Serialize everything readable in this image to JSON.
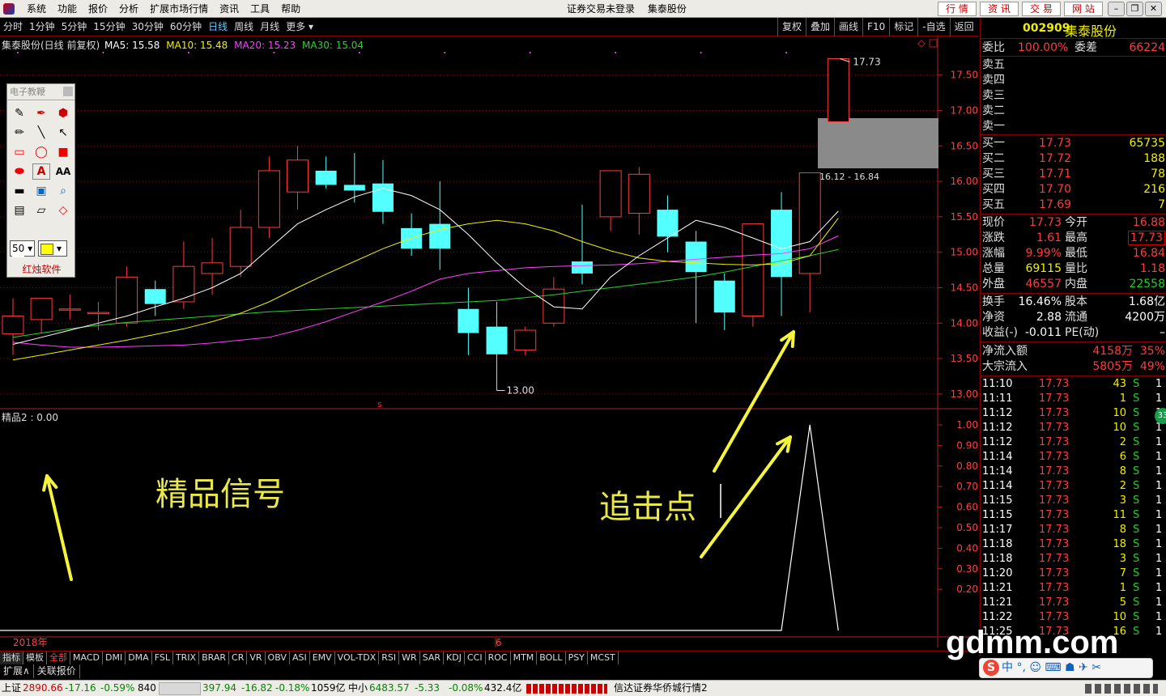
{
  "menubar": {
    "items": [
      "系统",
      "功能",
      "报价",
      "分析",
      "扩展市场行情",
      "资讯",
      "工具",
      "帮助"
    ],
    "status": "证券交易未登录",
    "stock": "集泰股份",
    "right_buttons": [
      "行 情",
      "资 讯",
      "交 易",
      "网 站"
    ]
  },
  "timeframes": {
    "items": [
      "分时",
      "1分钟",
      "5分钟",
      "15分钟",
      "30分钟",
      "60分钟",
      "日线",
      "周线",
      "月线",
      "更多 ▾"
    ],
    "active": "日线",
    "right_items": [
      "复权",
      "叠加",
      "画线",
      "F10",
      "标记",
      "-自选",
      "返回"
    ]
  },
  "chart_info": {
    "title": "集泰股份(日线 前复权)",
    "ma5": "MA5: 15.58",
    "ma10": "MA10: 15.48",
    "ma20": "MA20: 15.23",
    "ma30": "MA30: 15.04",
    "ma_colors": {
      "ma5": "#ffffff",
      "ma10": "#f0f000",
      "ma20": "#ff40ff",
      "ma30": "#30d030"
    }
  },
  "drawing_tools": {
    "title": "电子教鞭",
    "size_value": "50",
    "brand": "红烛软件",
    "tool_icons": [
      "eraser-icon",
      "pen-icon",
      "paint-icon",
      "brush-icon",
      "line-icon",
      "arrow-icon",
      "rect-outline-icon",
      "ellipse-outline-icon",
      "rect-fill-icon",
      "ellipse-fill-icon",
      "text-a-icon",
      "text-aa-icon",
      "black-bar-icon",
      "screen-icon",
      "magnifier-icon",
      "save-icon",
      "open-icon",
      "diamond-icon"
    ],
    "text_glyphs": {
      "text_a": "A",
      "text_aa": "AA"
    }
  },
  "chart_data": {
    "type": "candlestick",
    "y_ticks": [
      "17.50",
      "17.00",
      "16.50",
      "16.00",
      "15.50",
      "15.00",
      "14.50",
      "14.00",
      "13.50",
      "13.00"
    ],
    "ylim": [
      12.85,
      17.85
    ],
    "up_color": "#ff3b3b",
    "down_color": "#54ffff",
    "candles": [
      {
        "o": 13.85,
        "h": 14.35,
        "l": 13.55,
        "c": 14.1
      },
      {
        "o": 14.05,
        "h": 14.35,
        "l": 13.85,
        "c": 14.35
      },
      {
        "o": 14.2,
        "h": 14.4,
        "l": 14.05,
        "c": 14.2
      },
      {
        "o": 14.15,
        "h": 14.3,
        "l": 13.9,
        "c": 14.15
      },
      {
        "o": 14.0,
        "h": 14.8,
        "l": 13.95,
        "c": 14.65
      },
      {
        "o": 14.48,
        "h": 14.6,
        "l": 14.1,
        "c": 14.27
      },
      {
        "o": 14.3,
        "h": 15.15,
        "l": 14.2,
        "c": 14.8
      },
      {
        "o": 14.7,
        "h": 15.2,
        "l": 14.4,
        "c": 14.85
      },
      {
        "o": 14.8,
        "h": 15.6,
        "l": 14.65,
        "c": 15.35
      },
      {
        "o": 15.35,
        "h": 16.35,
        "l": 15.2,
        "c": 16.15
      },
      {
        "o": 15.85,
        "h": 16.5,
        "l": 15.6,
        "c": 16.3
      },
      {
        "o": 16.15,
        "h": 16.35,
        "l": 15.9,
        "c": 15.95
      },
      {
        "o": 15.95,
        "h": 16.4,
        "l": 15.7,
        "c": 15.87
      },
      {
        "o": 15.97,
        "h": 16.3,
        "l": 15.4,
        "c": 15.57
      },
      {
        "o": 15.34,
        "h": 15.55,
        "l": 14.95,
        "c": 15.05
      },
      {
        "o": 15.4,
        "h": 16.0,
        "l": 14.75,
        "c": 15.05
      },
      {
        "o": 14.2,
        "h": 14.5,
        "l": 13.55,
        "c": 13.86
      },
      {
        "o": 13.95,
        "h": 14.3,
        "l": 13.05,
        "c": 13.56
      },
      {
        "o": 13.62,
        "h": 13.95,
        "l": 13.55,
        "c": 13.9
      },
      {
        "o": 14.0,
        "h": 14.65,
        "l": 13.95,
        "c": 14.48
      },
      {
        "o": 14.87,
        "h": 15.67,
        "l": 14.55,
        "c": 14.7
      },
      {
        "o": 15.5,
        "h": 16.15,
        "l": 15.3,
        "c": 16.15
      },
      {
        "o": 15.55,
        "h": 16.2,
        "l": 15.25,
        "c": 16.1
      },
      {
        "o": 15.6,
        "h": 15.8,
        "l": 15.0,
        "c": 15.22
      },
      {
        "o": 15.15,
        "h": 15.3,
        "l": 14.0,
        "c": 14.72
      },
      {
        "o": 14.6,
        "h": 14.7,
        "l": 13.9,
        "c": 14.15
      },
      {
        "o": 14.1,
        "h": 15.4,
        "l": 13.95,
        "c": 15.4
      },
      {
        "o": 15.6,
        "h": 15.85,
        "l": 14.1,
        "c": 14.65
      },
      {
        "o": 14.7,
        "h": 16.12,
        "l": 14.15,
        "c": 16.12
      },
      {
        "o": 16.84,
        "h": 17.73,
        "l": 16.84,
        "c": 17.73
      }
    ],
    "ma5": [
      13.7,
      13.8,
      13.9,
      14.0,
      14.1,
      14.23,
      14.35,
      14.5,
      14.7,
      15.05,
      15.4,
      15.6,
      15.78,
      15.9,
      15.8,
      15.6,
      15.25,
      14.85,
      14.5,
      14.23,
      14.2,
      14.65,
      14.95,
      15.2,
      15.45,
      15.35,
      15.2,
      15.05,
      15.15,
      15.58
    ],
    "ma10": [
      13.48,
      13.55,
      13.62,
      13.69,
      13.76,
      13.84,
      13.92,
      14.02,
      14.14,
      14.3,
      14.5,
      14.69,
      14.87,
      15.05,
      15.2,
      15.32,
      15.4,
      15.45,
      15.4,
      15.3,
      15.15,
      15.02,
      14.92,
      14.87,
      14.85,
      14.83,
      14.82,
      14.84,
      14.95,
      15.48
    ],
    "ma20": [
      13.73,
      13.69,
      13.66,
      13.66,
      13.67,
      13.68,
      13.69,
      13.72,
      13.76,
      13.8,
      13.9,
      14.02,
      14.16,
      14.3,
      14.45,
      14.62,
      14.7,
      14.74,
      14.78,
      14.8,
      14.81,
      14.82,
      14.84,
      14.87,
      14.9,
      14.93,
      14.96,
      14.98,
      15.05,
      15.23
    ],
    "ma30": [
      13.8,
      13.86,
      13.92,
      13.97,
      14.01,
      14.04,
      14.07,
      14.1,
      14.13,
      14.16,
      14.18,
      14.2,
      14.22,
      14.24,
      14.26,
      14.28,
      14.3,
      14.32,
      14.36,
      14.4,
      14.45,
      14.5,
      14.55,
      14.6,
      14.65,
      14.72,
      14.8,
      14.88,
      14.95,
      15.04
    ],
    "max_label": "17.73",
    "min_label": "13.00",
    "range_label": "16.12 - 16.84",
    "indicator": {
      "name": "精品2 : 0.00",
      "y_ticks": [
        "1.00",
        "0.90",
        "0.80",
        "0.70",
        "0.60",
        "0.50",
        "0.40",
        "0.30",
        "0.20"
      ],
      "ylim": [
        0,
        1
      ],
      "signal": [
        0,
        0,
        0,
        0,
        0,
        0,
        0,
        0,
        0,
        0,
        0,
        0,
        0,
        0,
        0,
        0,
        0,
        0,
        0,
        0,
        0,
        0,
        0,
        0,
        0,
        0,
        0,
        0,
        1,
        0
      ]
    },
    "x_labels": [
      "2018年",
      "6"
    ]
  },
  "annotations": {
    "signal_label": "精品信号",
    "chase_label": "追击点"
  },
  "quote_panel": {
    "code": "002909",
    "name": "集泰股份",
    "weibi": {
      "label": "委比",
      "value": "100.00%",
      "label2": "委差",
      "value2": "66224"
    },
    "sells": [
      {
        "label": "卖五",
        "price": "",
        "vol": ""
      },
      {
        "label": "卖四",
        "price": "",
        "vol": ""
      },
      {
        "label": "卖三",
        "price": "",
        "vol": ""
      },
      {
        "label": "卖二",
        "price": "",
        "vol": ""
      },
      {
        "label": "卖一",
        "price": "",
        "vol": ""
      }
    ],
    "buys": [
      {
        "label": "买一",
        "price": "17.73",
        "vol": "65735"
      },
      {
        "label": "买二",
        "price": "17.72",
        "vol": "188"
      },
      {
        "label": "买三",
        "price": "17.71",
        "vol": "78"
      },
      {
        "label": "买四",
        "price": "17.70",
        "vol": "216"
      },
      {
        "label": "买五",
        "price": "17.69",
        "vol": "7"
      }
    ],
    "stats": [
      {
        "l1": "现价",
        "v1": "17.73",
        "c1": "red",
        "l2": "今开",
        "v2": "16.88",
        "c2": "red"
      },
      {
        "l1": "涨跌",
        "v1": "1.61",
        "c1": "red",
        "l2": "最高",
        "v2": "17.73",
        "c2": "red"
      },
      {
        "l1": "涨幅",
        "v1": "9.99%",
        "c1": "red",
        "l2": "最低",
        "v2": "16.84",
        "c2": "red"
      },
      {
        "l1": "总量",
        "v1": "69115",
        "c1": "yel",
        "l2": "量比",
        "v2": "1.18",
        "c2": "red"
      },
      {
        "l1": "外盘",
        "v1": "46557",
        "c1": "red",
        "l2": "内盘",
        "v2": "22558",
        "c2": "grn"
      }
    ],
    "stats2": [
      {
        "l1": "换手",
        "v1": "16.46%",
        "l2": "股本",
        "v2": "1.68亿"
      },
      {
        "l1": "净资",
        "v1": "2.88",
        "l2": "流通",
        "v2": "4200万"
      },
      {
        "l1": "收益(-)",
        "v1": "-0.011",
        "l2": "PE(动)",
        "v2": "–"
      }
    ],
    "flows": [
      {
        "label": "净流入额",
        "value": "4158万",
        "pct": "35%"
      },
      {
        "label": "大宗流入",
        "value": "5805万",
        "pct": "49%"
      }
    ],
    "ticks": [
      {
        "t": "11:10",
        "p": "17.73",
        "v": "43",
        "s": "S",
        "n": "1"
      },
      {
        "t": "11:11",
        "p": "17.73",
        "v": "1",
        "s": "S",
        "n": "1"
      },
      {
        "t": "11:12",
        "p": "17.73",
        "v": "10",
        "s": "S",
        "n": "1"
      },
      {
        "t": "11:12",
        "p": "17.73",
        "v": "10",
        "s": "S",
        "n": "1"
      },
      {
        "t": "11:12",
        "p": "17.73",
        "v": "2",
        "s": "S",
        "n": "1"
      },
      {
        "t": "11:14",
        "p": "17.73",
        "v": "6",
        "s": "S",
        "n": "1"
      },
      {
        "t": "11:14",
        "p": "17.73",
        "v": "8",
        "s": "S",
        "n": "1"
      },
      {
        "t": "11:14",
        "p": "17.73",
        "v": "2",
        "s": "S",
        "n": "1"
      },
      {
        "t": "11:15",
        "p": "17.73",
        "v": "3",
        "s": "S",
        "n": "1"
      },
      {
        "t": "11:15",
        "p": "17.73",
        "v": "11",
        "s": "S",
        "n": "1"
      },
      {
        "t": "11:17",
        "p": "17.73",
        "v": "8",
        "s": "S",
        "n": "1"
      },
      {
        "t": "11:18",
        "p": "17.73",
        "v": "18",
        "s": "S",
        "n": "1"
      },
      {
        "t": "11:18",
        "p": "17.73",
        "v": "3",
        "s": "S",
        "n": "1"
      },
      {
        "t": "11:20",
        "p": "17.73",
        "v": "7",
        "s": "S",
        "n": "1"
      },
      {
        "t": "11:21",
        "p": "17.73",
        "v": "1",
        "s": "S",
        "n": "1"
      },
      {
        "t": "11:21",
        "p": "17.73",
        "v": "5",
        "s": "S",
        "n": "1"
      },
      {
        "t": "11:22",
        "p": "17.73",
        "v": "10",
        "s": "S",
        "n": "1"
      },
      {
        "t": "11:25",
        "p": "17.73",
        "v": "16",
        "s": "S",
        "n": "1"
      }
    ],
    "badge": "33"
  },
  "indicator_tabs": {
    "items": [
      "指标",
      "模板",
      "全部",
      "MACD",
      "DMI",
      "DMA",
      "FSL",
      "TRIX",
      "BRAR",
      "CR",
      "VR",
      "OBV",
      "ASI",
      "EMV",
      "VOL-TDX",
      "RSI",
      "WR",
      "SAR",
      "KDJ",
      "CCI",
      "ROC",
      "MTM",
      "BOLL",
      "PSY",
      "MCST"
    ],
    "active": "全部"
  },
  "ext_tabs": [
    "扩展∧",
    "关联报价"
  ],
  "statusbar": {
    "sh_label": "上证",
    "sh_val": "2890.66",
    "sh_chg": "-17.16",
    "sh_pct": "-0.59%",
    "sh_amt": "840",
    "sz_val": "397.94",
    "sz_chg": "-16.82",
    "sz_pct": "-0.18%",
    "sz_amt": "1059亿",
    "zx_label": "中小",
    "zx_val": "6483.57",
    "zx_chg": "-5.33",
    "zx_pct": "-0.08%",
    "zx_amt": "432.4亿",
    "server": "信达证券华侨城行情2"
  },
  "ime": {
    "logo": "S",
    "text": "中 °, ☺ ⌨ ☗ ✈ ✂"
  },
  "watermark": "gdmm.com"
}
